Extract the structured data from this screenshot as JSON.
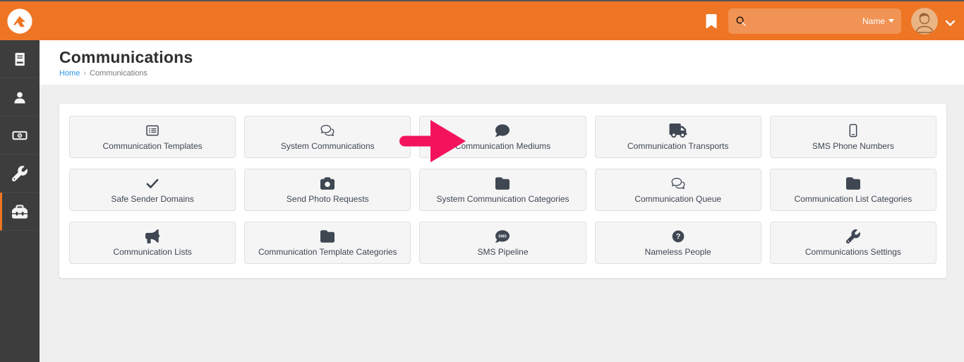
{
  "colors": {
    "topbar": "#ee7524",
    "accent": "#ee7524",
    "arrow": "#f3135c",
    "link_blue": "#2d96e8",
    "sidebar_bg": "#3d3d3d",
    "page_bg": "#efefef",
    "card_bg": "#f5f5f5"
  },
  "topbar": {
    "search": {
      "value": "",
      "placeholder": ""
    },
    "search_type_label": "Name"
  },
  "sidebar": {
    "items": [
      {
        "id": "pages",
        "icon": "book-icon",
        "active": false
      },
      {
        "id": "people",
        "icon": "person-icon",
        "active": false
      },
      {
        "id": "finance",
        "icon": "money-icon",
        "active": false
      },
      {
        "id": "tools",
        "icon": "wrench-icon",
        "active": false
      },
      {
        "id": "admin",
        "icon": "toolbox-icon",
        "active": true
      }
    ]
  },
  "page": {
    "title": "Communications",
    "breadcrumb": {
      "home": "Home",
      "separator": "›",
      "current": "Communications"
    }
  },
  "cards": [
    {
      "label": "Communication Templates",
      "icon": "list-template-icon"
    },
    {
      "label": "System Communications",
      "icon": "comments-icon"
    },
    {
      "label": "Communication Mediums",
      "icon": "comment-icon"
    },
    {
      "label": "Communication Transports",
      "icon": "truck-icon"
    },
    {
      "label": "SMS Phone Numbers",
      "icon": "mobile-icon"
    },
    {
      "label": "Safe Sender Domains",
      "icon": "check-icon"
    },
    {
      "label": "Send Photo Requests",
      "icon": "camera-icon"
    },
    {
      "label": "System Communication Categories",
      "icon": "folder-icon"
    },
    {
      "label": "Communication Queue",
      "icon": "comments-icon"
    },
    {
      "label": "Communication List Categories",
      "icon": "folder-icon"
    },
    {
      "label": "Communication Lists",
      "icon": "bullhorn-icon"
    },
    {
      "label": "Communication Template Categories",
      "icon": "folder-icon"
    },
    {
      "label": "SMS Pipeline",
      "icon": "sms-comment-icon"
    },
    {
      "label": "Nameless People",
      "icon": "question-circle-icon"
    },
    {
      "label": "Communications Settings",
      "icon": "wrench-icon"
    }
  ],
  "icon_glyphs": {
    "sms_label": "SMS",
    "question_glyph": "?"
  },
  "annotation": {
    "type": "arrow",
    "points_to": "Communication Mediums"
  }
}
